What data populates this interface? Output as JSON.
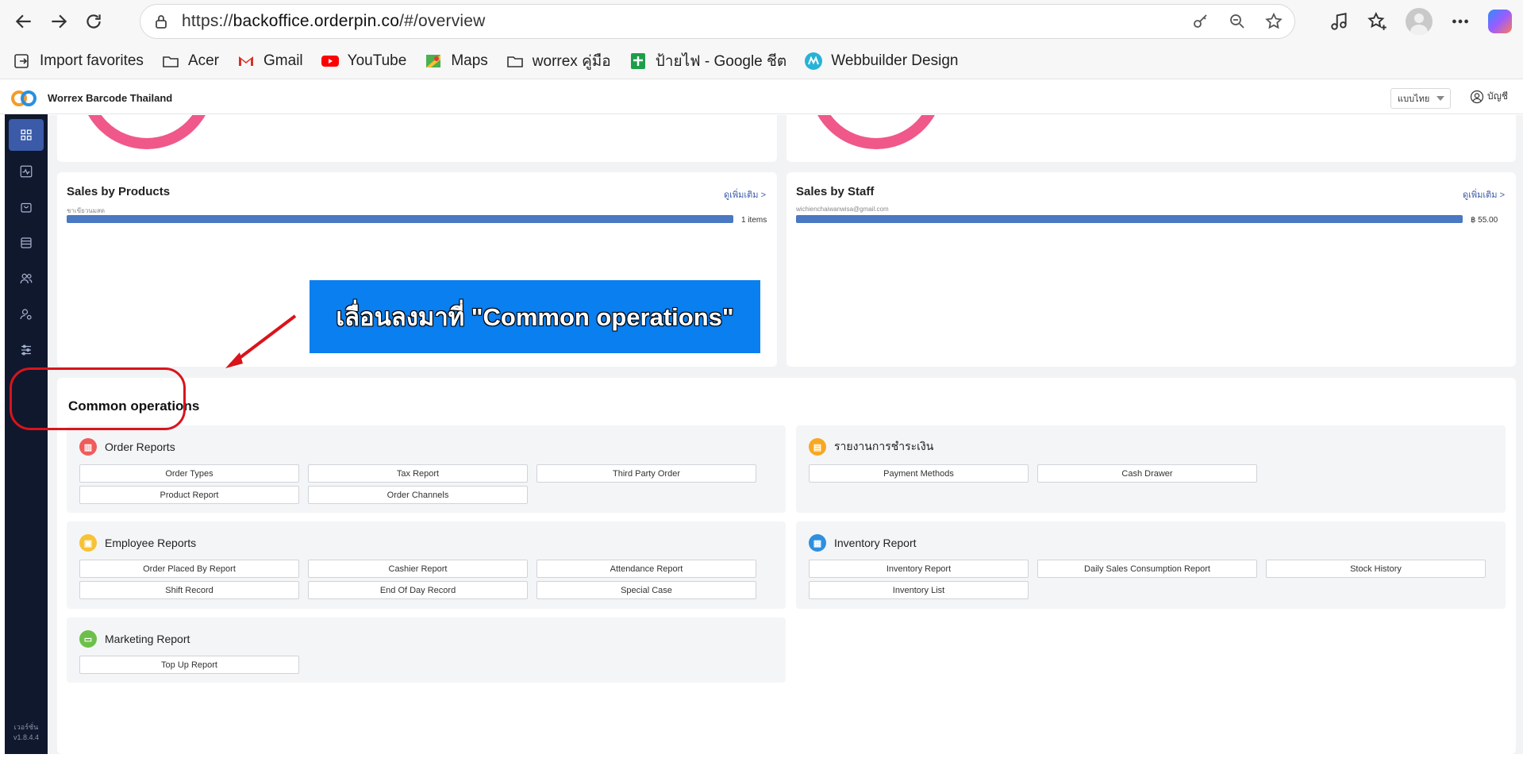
{
  "browser": {
    "url_scheme": "https://",
    "url_host": "backoffice.orderpin.co",
    "url_path": "/#/overview",
    "favorites": [
      {
        "label": "Import favorites",
        "icon": "import-icon"
      },
      {
        "label": "Acer",
        "icon": "folder-icon"
      },
      {
        "label": "Gmail",
        "icon": "gmail-icon"
      },
      {
        "label": "YouTube",
        "icon": "youtube-icon"
      },
      {
        "label": "Maps",
        "icon": "maps-icon"
      },
      {
        "label": "worrex คู่มือ",
        "icon": "folder-icon"
      },
      {
        "label": "ป้ายไฟ - Google ชีต",
        "icon": "sheets-icon"
      },
      {
        "label": "Webbuilder Design",
        "icon": "webbuilder-icon"
      }
    ]
  },
  "app": {
    "name": "Worrex Barcode Thailand",
    "language": "แบบไทย",
    "account": "บัญชี",
    "version_label": "เวอร์ชั่น",
    "version": "v1.8.4.4"
  },
  "sales_by_products": {
    "title": "Sales by Products",
    "more": "ดูเพิ่มเติม >",
    "item_label": "ชาเขียวนมสด",
    "value": "1 items",
    "fill": 1.0
  },
  "sales_by_staff": {
    "title": "Sales by Staff",
    "more": "ดูเพิ่มเติม >",
    "item_label": "wichienchaiwanwisa@gmail.com",
    "value": "฿ 55.00",
    "fill": 1.0
  },
  "callout": {
    "text": "เลื่อนลงมาที่ \"Common operations\""
  },
  "common_operations": {
    "title": "Common operations",
    "groups": [
      {
        "title": "Order Reports",
        "icon_color": "#f05b5b",
        "items": [
          "Order Types",
          "Tax Report",
          "Third Party Order",
          "Product Report",
          "Order Channels"
        ]
      },
      {
        "title": "รายงานการชำระเงิน",
        "icon_color": "#f7a823",
        "items": [
          "Payment Methods",
          "Cash Drawer"
        ]
      },
      {
        "title": "Employee Reports",
        "icon_color": "#f7c236",
        "items": [
          "Order Placed By Report",
          "Cashier Report",
          "Attendance Report",
          "Shift Record",
          "End Of Day Record",
          "Special Case"
        ]
      },
      {
        "title": "Inventory Report",
        "icon_color": "#2f8fe0",
        "items": [
          "Inventory Report",
          "Daily Sales Consumption Report",
          "Stock History",
          "Inventory List"
        ]
      },
      {
        "title": "Marketing Report",
        "icon_color": "#6cc04a",
        "items": [
          "Top Up Report"
        ]
      }
    ]
  }
}
